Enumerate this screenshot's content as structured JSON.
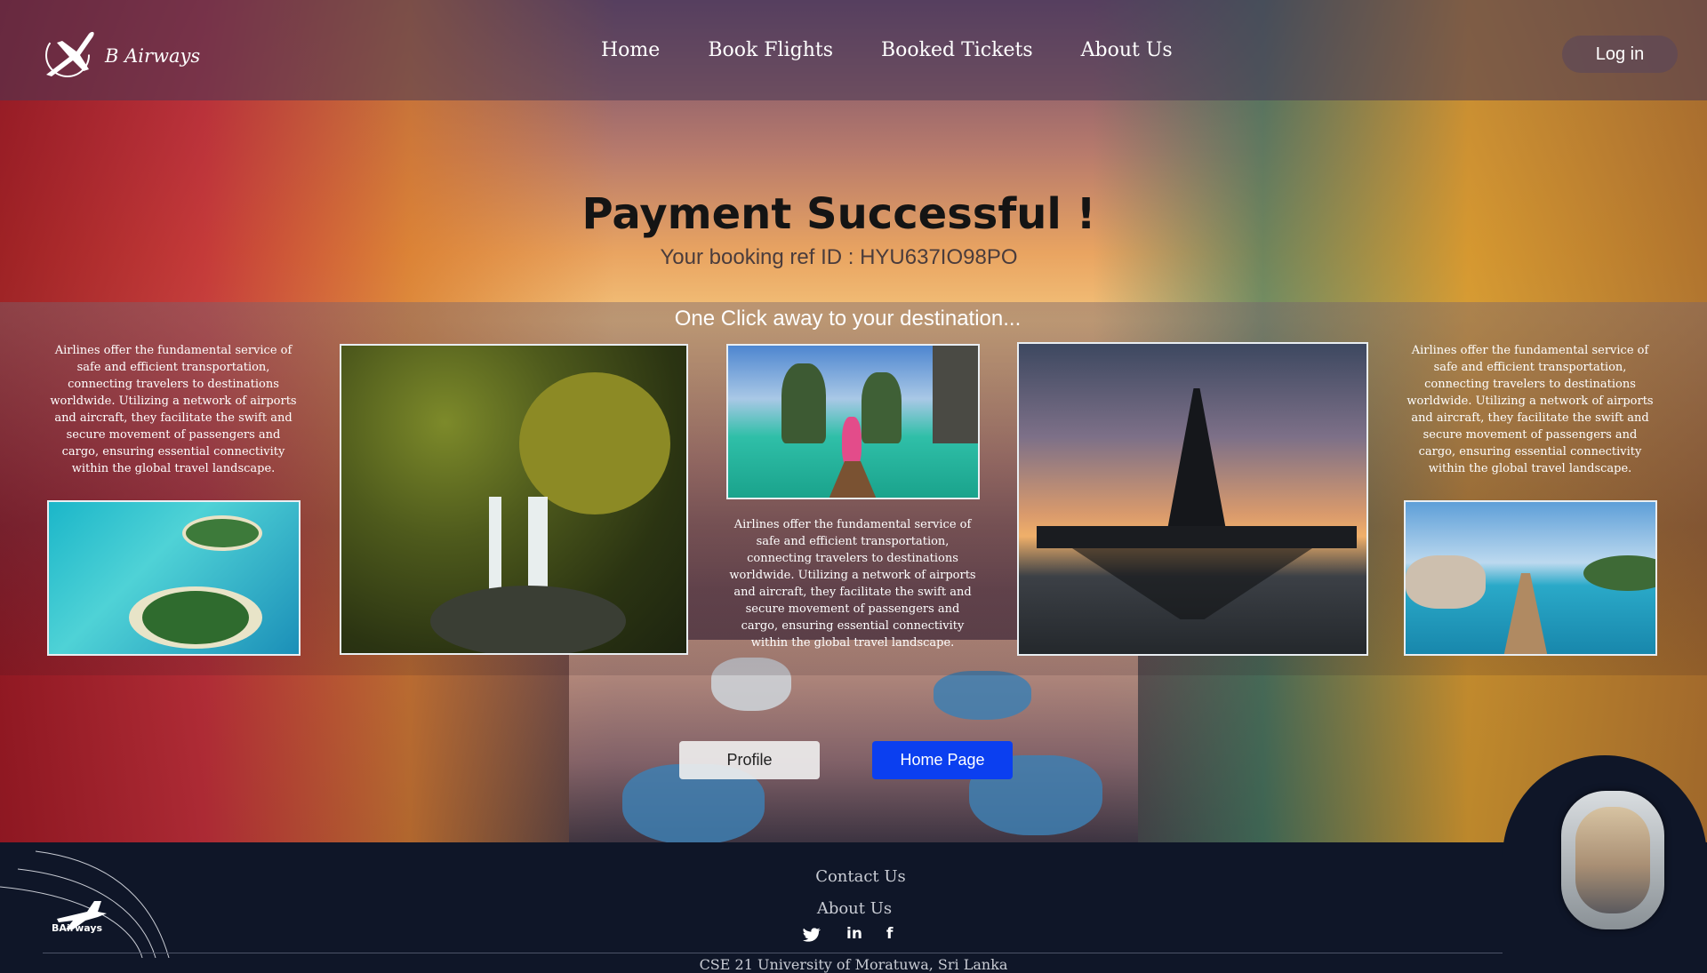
{
  "header": {
    "brand": "B Airways",
    "nav": [
      "Home",
      "Book Flights",
      "Booked Tickets",
      "About Us"
    ],
    "login_label": "Log in"
  },
  "main": {
    "title": "Payment Successful !",
    "booking_ref": "Your booking ref ID : HYU637IO98PO",
    "tagline": "One Click away to your destination...",
    "description": "Airlines offer the fundamental service of safe and efficient transportation, connecting travelers to destinations worldwide. Utilizing a network of airports and aircraft, they facilitate the swift and secure movement of passengers and cargo, ensuring essential connectivity within the global travel landscape.",
    "buttons": {
      "profile": "Profile",
      "home": "Home Page"
    }
  },
  "footer": {
    "brand": "BAirways",
    "links": [
      "Contact Us",
      "About Us"
    ],
    "social": [
      "twitter-icon",
      "linkedin-icon",
      "facebook-icon"
    ],
    "copyright": "CSE 21 University of Moratuwa, Sri Lanka"
  },
  "colors": {
    "primary_button": "#0b3ff0",
    "footer_bg": "#0f1628"
  }
}
